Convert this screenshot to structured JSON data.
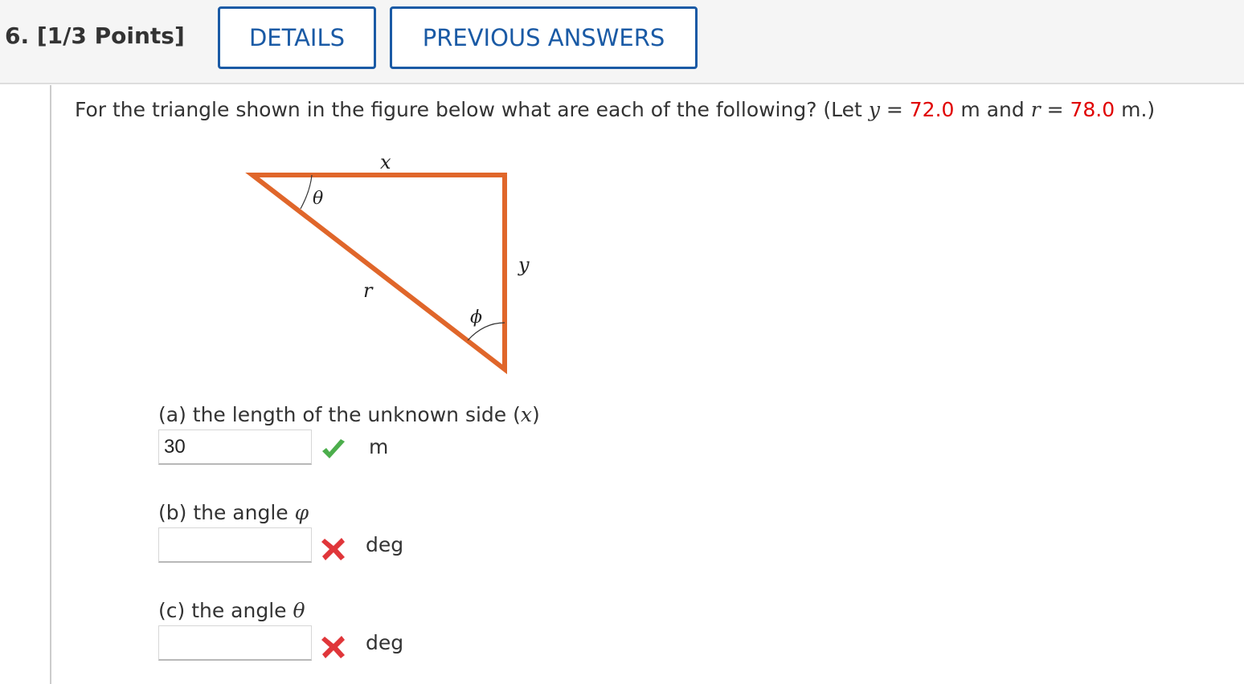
{
  "header": {
    "question_label": "6.  [1/3 Points]",
    "details_button": "DETAILS",
    "previous_answers_button": "PREVIOUS ANSWERS"
  },
  "prompt": {
    "before": "For the triangle shown in the figure below what are each of the following? (Let ",
    "var_y": "y",
    "eq1": " = ",
    "y_value": "72.0",
    "mid": " m and ",
    "var_r": "r",
    "eq2": " = ",
    "r_value": "78.0",
    "after": " m.)"
  },
  "figure": {
    "label_x": "x",
    "label_y": "y",
    "label_r": "r",
    "label_theta": "θ",
    "label_phi": "ϕ",
    "triangle_color": "#e0662a"
  },
  "parts": {
    "a": {
      "label": "(a) the length of the unknown side (",
      "symbol": "x",
      "label_end": ")",
      "value": "30",
      "status": "correct",
      "status_icon": "check-icon",
      "unit": "m"
    },
    "b": {
      "label": "(b) the angle ",
      "symbol": "φ",
      "value": "",
      "status": "incorrect",
      "status_icon": "x-mark-icon",
      "unit": "deg"
    },
    "c": {
      "label": "(c) the angle ",
      "symbol": "θ",
      "value": "",
      "status": "incorrect",
      "status_icon": "x-mark-icon",
      "unit": "deg"
    }
  },
  "colors": {
    "accent": "#1a5aa5",
    "given_value": "#e00000",
    "correct": "#4cae4c",
    "incorrect": "#e0363a"
  }
}
